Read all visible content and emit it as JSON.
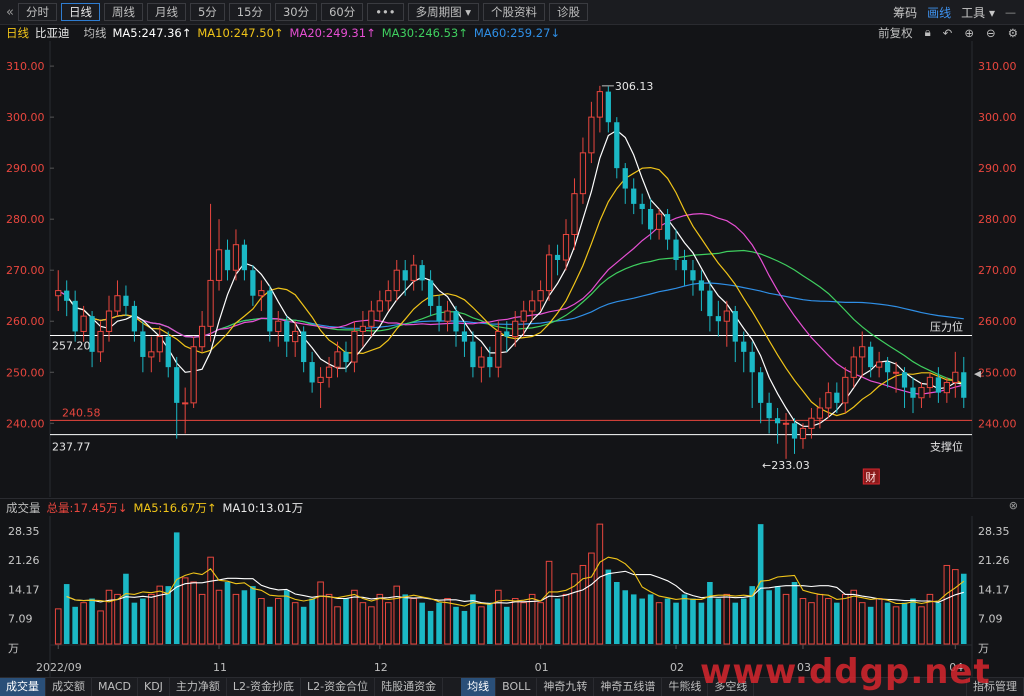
{
  "toolbar": {
    "back_icon": "double-chevron-left-icon",
    "tabs": [
      {
        "label": "分时",
        "active": false
      },
      {
        "label": "日线",
        "active": true
      },
      {
        "label": "周线",
        "active": false
      },
      {
        "label": "月线",
        "active": false
      },
      {
        "label": "5分",
        "active": false
      },
      {
        "label": "15分",
        "active": false
      },
      {
        "label": "30分",
        "active": false
      },
      {
        "label": "60分",
        "active": false
      },
      {
        "label": "•••",
        "active": false
      },
      {
        "label": "多周期图 ▾",
        "active": false
      },
      {
        "label": "个股资料",
        "active": false
      },
      {
        "label": "诊股",
        "active": false
      }
    ],
    "right": {
      "chips": "筹码",
      "draw": "画线",
      "tools": "工具 ▾"
    }
  },
  "legend": {
    "period": "日线",
    "name": "比亚迪",
    "mode": "均线",
    "ma5": "MA5:247.36↑",
    "ma10": "MA10:247.50↑",
    "ma20": "MA20:249.31↑",
    "ma30": "MA30:246.53↑",
    "ma60": "MA60:259.27↓",
    "adjust": "前复权"
  },
  "volume_header": {
    "title": "成交量",
    "total": "总量:17.45万↓",
    "ma5": "MA5:16.67万↑",
    "ma10": "MA10:13.01万"
  },
  "bottom_tabs": {
    "left": [
      {
        "label": "成交量",
        "active": true
      },
      {
        "label": "成交额",
        "active": false
      },
      {
        "label": "MACD",
        "active": false
      },
      {
        "label": "KDJ",
        "active": false
      },
      {
        "label": "主力净额",
        "active": false
      },
      {
        "label": "L2-资金抄底",
        "active": false
      },
      {
        "label": "L2-资金合位",
        "active": false
      },
      {
        "label": "陆股通资金",
        "active": false
      }
    ],
    "right": [
      {
        "label": "均线",
        "active": true
      },
      {
        "label": "BOLL",
        "active": false
      },
      {
        "label": "神奇九转",
        "active": false
      },
      {
        "label": "神奇五线谱",
        "active": false
      },
      {
        "label": "牛熊线",
        "active": false
      },
      {
        "label": "多空线",
        "active": false
      }
    ],
    "manage": "指标管理"
  },
  "watermark": "www.ddgp.net",
  "colors": {
    "up": "#e8463e",
    "down": "#1bb8c5",
    "ma5": "#ffffff",
    "ma10": "#f0c419",
    "ma20": "#e64fd3",
    "ma30": "#3fcf5f",
    "ma60": "#2f8fe6",
    "axis_red": "#e8463e"
  },
  "chart_data": [
    {
      "type": "candlestick",
      "title": "比亚迪 日线",
      "ylim": [
        233,
        311
      ],
      "yticks": [
        "310.00",
        "300.00",
        "290.00",
        "280.00",
        "270.00",
        "260.00",
        "250.00",
        "240.00"
      ],
      "xticks": [
        "2022/09",
        "11",
        "12",
        "01",
        "02",
        "03",
        "04"
      ],
      "annotations": {
        "high": "306.13",
        "low": "←233.03",
        "resistance_value": "257.20",
        "resistance_label": "压力位",
        "current_value": "240.58",
        "support_value": "237.77",
        "support_label": "支撑位",
        "event_badge": "财"
      },
      "candles": {
        "open": [
          265,
          266,
          264,
          258,
          261,
          254,
          258,
          262,
          265,
          263,
          258,
          253,
          254,
          257,
          251,
          244,
          244,
          255,
          259,
          268,
          274,
          270,
          275,
          270,
          265,
          266,
          258,
          260,
          256,
          258,
          252,
          248,
          249,
          251,
          254,
          252,
          258,
          259,
          262,
          264,
          266,
          270,
          268,
          271,
          268,
          263,
          260,
          262,
          258,
          256,
          251,
          253,
          251,
          258,
          257,
          260,
          262,
          264,
          266,
          273,
          272,
          277,
          285,
          293,
          300,
          305,
          299,
          290,
          286,
          283,
          282,
          278,
          281,
          276,
          272,
          270,
          268,
          266,
          261,
          260,
          262,
          256,
          254,
          250,
          244,
          241,
          240,
          240,
          237,
          239,
          241,
          243,
          246,
          244,
          249,
          253,
          255,
          251,
          252,
          250,
          250,
          247,
          245,
          247,
          249,
          246,
          248,
          250
        ],
        "close": [
          266,
          264,
          258,
          261,
          254,
          258,
          262,
          265,
          263,
          258,
          253,
          254,
          257,
          251,
          244,
          244,
          255,
          259,
          268,
          274,
          270,
          275,
          270,
          265,
          266,
          258,
          260,
          256,
          258,
          252,
          248,
          249,
          251,
          254,
          252,
          258,
          259,
          262,
          264,
          266,
          270,
          268,
          271,
          268,
          263,
          260,
          262,
          258,
          256,
          251,
          253,
          251,
          258,
          257,
          260,
          262,
          264,
          266,
          273,
          272,
          277,
          285,
          293,
          300,
          305,
          299,
          290,
          286,
          283,
          282,
          278,
          281,
          276,
          272,
          270,
          268,
          266,
          261,
          260,
          262,
          256,
          254,
          250,
          244,
          241,
          240,
          240,
          237,
          239,
          241,
          243,
          246,
          244,
          249,
          253,
          255,
          251,
          252,
          250,
          250,
          247,
          245,
          247,
          249,
          246,
          248,
          250,
          245
        ],
        "high": [
          270,
          268,
          266,
          263,
          262,
          260,
          265,
          268,
          267,
          264,
          260,
          257,
          259,
          258,
          253,
          247,
          257,
          262,
          283,
          280,
          276,
          278,
          276,
          271,
          268,
          267,
          262,
          261,
          260,
          259,
          254,
          251,
          253,
          256,
          256,
          260,
          262,
          264,
          266,
          268,
          272,
          272,
          273,
          272,
          270,
          265,
          264,
          263,
          260,
          258,
          255,
          255,
          260,
          260,
          262,
          264,
          266,
          268,
          275,
          275,
          280,
          288,
          296,
          303,
          306.13,
          306,
          300,
          291,
          288,
          285,
          284,
          282,
          282,
          278,
          274,
          272,
          270,
          268,
          264,
          264,
          263,
          258,
          256,
          251,
          246,
          243,
          242,
          241,
          240,
          243,
          245,
          248,
          248,
          251,
          255,
          258,
          256,
          254,
          253,
          252,
          251,
          249,
          248,
          250,
          251,
          249,
          254,
          253
        ],
        "low": [
          262,
          261,
          256,
          256,
          251,
          252,
          256,
          261,
          261,
          256,
          250,
          250,
          252,
          249,
          237,
          238,
          243,
          254,
          256,
          266,
          268,
          268,
          268,
          263,
          262,
          256,
          255,
          253,
          253,
          250,
          246,
          243,
          247,
          249,
          250,
          250,
          255,
          257,
          260,
          262,
          264,
          265,
          266,
          266,
          261,
          258,
          258,
          255,
          253,
          249,
          248,
          249,
          249,
          254,
          255,
          257,
          260,
          262,
          264,
          269,
          270,
          274,
          283,
          291,
          297,
          297,
          288,
          283,
          281,
          279,
          276,
          276,
          274,
          270,
          267,
          265,
          262,
          258,
          257,
          255,
          252,
          250,
          243,
          240,
          238,
          236,
          233.03,
          234,
          235,
          237,
          239,
          241,
          242,
          242,
          247,
          249,
          249,
          249,
          247,
          246,
          243,
          242,
          243,
          245,
          244,
          244,
          245,
          243
        ]
      },
      "moving_averages": {
        "ma5": "MA5:247.36↑",
        "ma10": "MA10:247.50↑",
        "ma20": "MA20:249.31↑",
        "ma30": "MA30:246.53↑",
        "ma60": "MA60:259.27↓"
      }
    },
    {
      "type": "bar",
      "title": "成交量",
      "unit": "万",
      "ylim": [
        0,
        30
      ],
      "yticks": [
        "28.35",
        "21.26",
        "14.17",
        "7.09",
        "万"
      ],
      "xticks": [
        "2022/09",
        "11",
        "12",
        "01",
        "02",
        "03",
        "04"
      ],
      "values": [
        8.5,
        14.5,
        9,
        10,
        11,
        8,
        13,
        12,
        17,
        10,
        11,
        12,
        14,
        14,
        27,
        16,
        15,
        12,
        21,
        13,
        15,
        12,
        13,
        14,
        11,
        9,
        11,
        13,
        10,
        9,
        11,
        15,
        12,
        9,
        11,
        13,
        10,
        9,
        12,
        10,
        14,
        12,
        11,
        10,
        8,
        10,
        11,
        9,
        8,
        12,
        9,
        10,
        13,
        9,
        11,
        10,
        12,
        10,
        20,
        11,
        12,
        17,
        19,
        22,
        29,
        18,
        15,
        13,
        12,
        11,
        12,
        10,
        11,
        10,
        12,
        11,
        10,
        15,
        11,
        12,
        10,
        11,
        14,
        29,
        13,
        14,
        12,
        15,
        11,
        10,
        12,
        11,
        10,
        12,
        13,
        10,
        9,
        11,
        10,
        9,
        10,
        11,
        9,
        12,
        10,
        19,
        18,
        17
      ]
    }
  ]
}
